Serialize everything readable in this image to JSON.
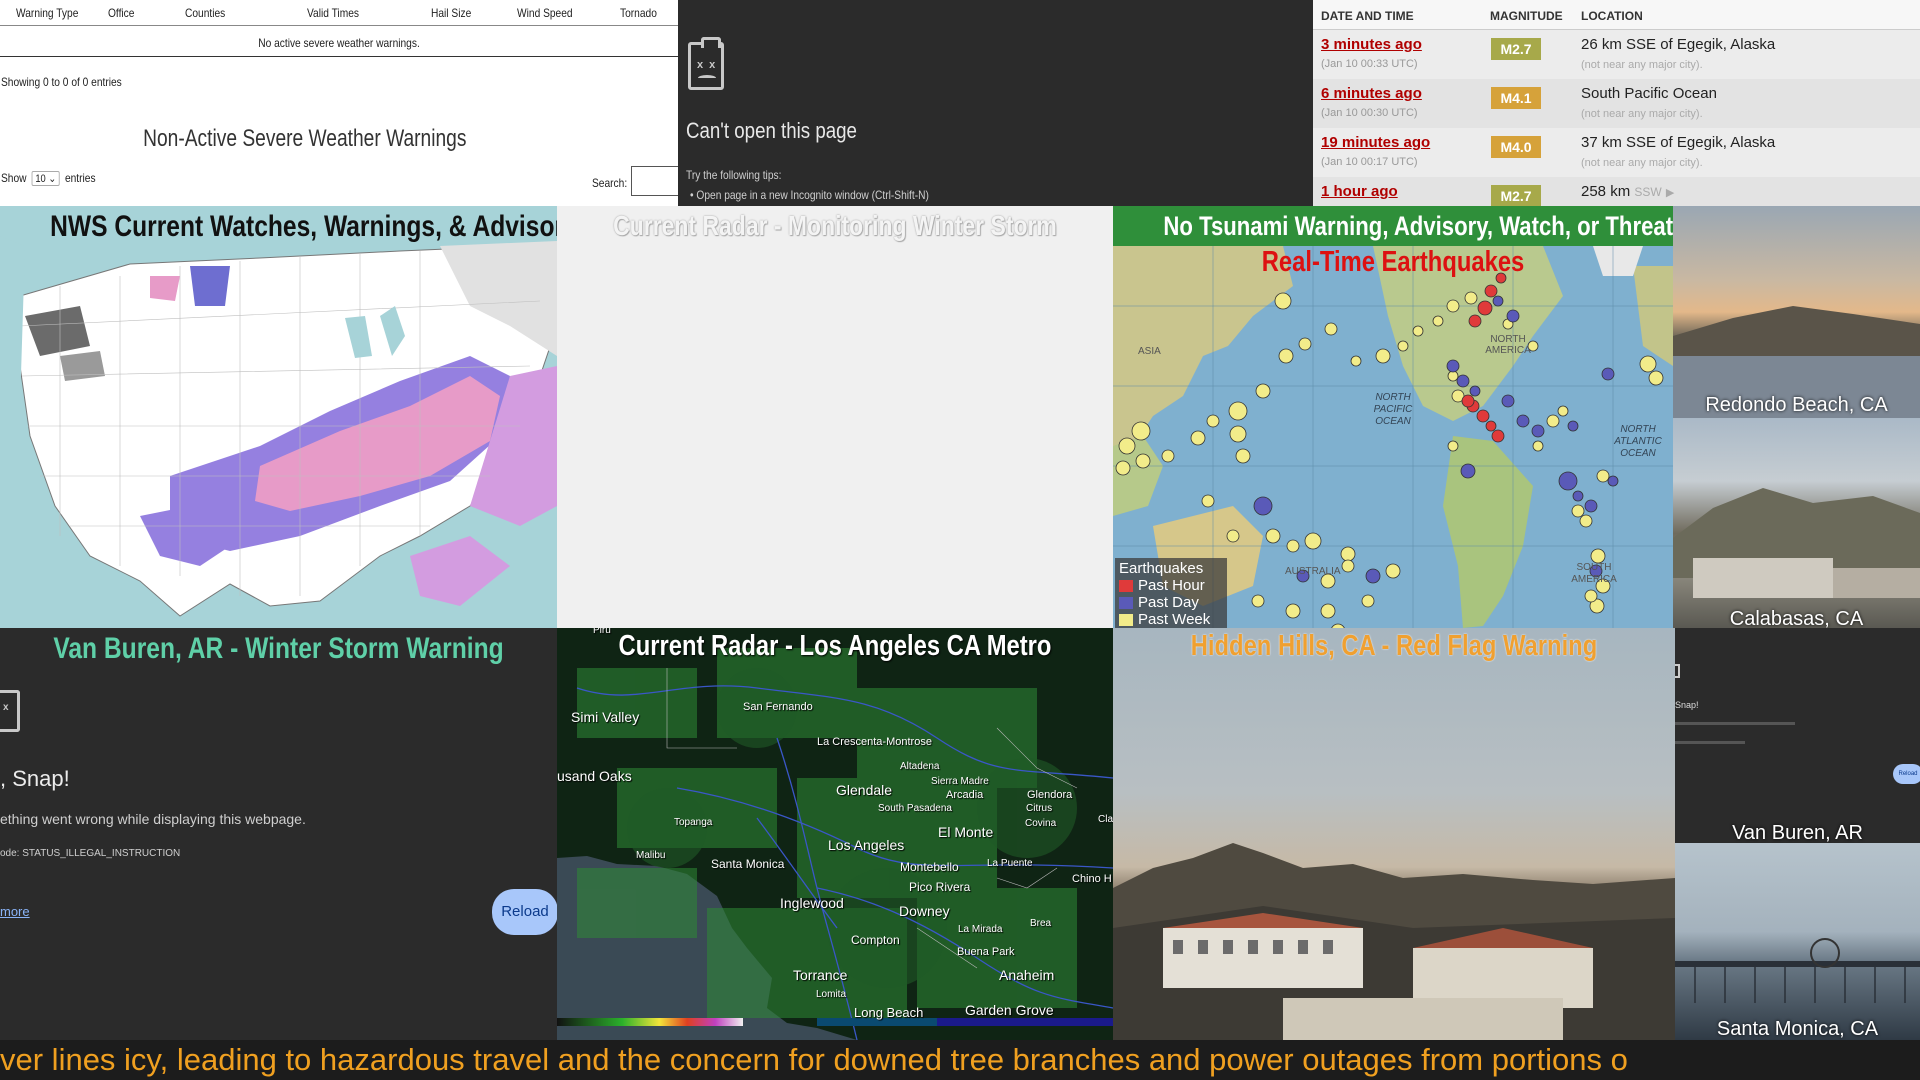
{
  "warnings_table": {
    "columns": [
      "Warning Type",
      "Office",
      "Counties",
      "Valid Times",
      "Hail Size",
      "Wind Speed",
      "Tornado"
    ],
    "empty_text": "No active severe weather warnings.",
    "showing_text": "Showing 0 to 0 of 0 entries",
    "section_title": "Non-Active Severe Weather Warnings",
    "show_label": "Show",
    "show_value": "10",
    "entries_label": "entries",
    "search_label": "Search:"
  },
  "error_page": {
    "title": "Can't open this page",
    "tips_label": "Try the following tips:",
    "tip_1": "Open page in a new Incognito window (Ctrl-Shift-N)"
  },
  "quake_table": {
    "headers": [
      "DATE AND TIME",
      "MAGNITUDE",
      "LOCATION"
    ],
    "rows": [
      {
        "time": "3 minutes ago",
        "utc": "(Jan 10 00:33 UTC)",
        "mag": "M2.7",
        "location": "26 km SSE of Egegik, Alaska",
        "near": "(not near any major city)."
      },
      {
        "time": "6 minutes ago",
        "utc": "(Jan 10 00:30 UTC)",
        "mag": "M4.1",
        "location": "South Pacific Ocean",
        "near": "(not near any major city)."
      },
      {
        "time": "19 minutes ago",
        "utc": "(Jan 10 00:17 UTC)",
        "mag": "M4.0",
        "location": "37 km SSE of Egegik, Alaska",
        "near": "(not near any major city)."
      },
      {
        "time": "1 hour ago",
        "utc": "",
        "mag": "M2.7",
        "location": "258 km",
        "location_dir": "SSW"
      }
    ]
  },
  "panels": {
    "nws_title": "NWS Current Watches, Warnings, & Advisories",
    "radar_title": "Current Radar - Monitoring Winter Storm",
    "tsunami_banner": "No Tsunami Warning, Advisory, Watch, or Threat",
    "quake_map_title": "Real-Time Earthquakes",
    "van_buren_title": "Van Buren, AR - Winter Storm Warning",
    "la_radar_title": "Current Radar - Los Angeles CA Metro",
    "hidden_hills_title": "Hidden Hills, CA - Red Flag Warning"
  },
  "quake_map": {
    "labels": {
      "asia": "ASIA",
      "north_america": "NORTH AMERICA",
      "north_pacific": "NORTH PACIFIC OCEAN",
      "north_atlantic": "NORTH ATLANTIC OCEAN",
      "south_america": "SOUTH AMERICA",
      "australia": "AUSTRALIA"
    },
    "legend_title": "Earthquakes",
    "legend": [
      {
        "label": "Past Hour",
        "color": "#e03a3a"
      },
      {
        "label": "Past Day",
        "color": "#5a5ab8"
      },
      {
        "label": "Past Week",
        "color": "#f2ec8a"
      }
    ]
  },
  "webcams": {
    "redondo": "Redondo Beach, CA",
    "calabasas": "Calabasas, CA",
    "van_buren": "Van Buren, AR",
    "santa_monica": "Santa Monica, CA",
    "snap": "Snap!",
    "reload": "Reload"
  },
  "van_buren_error": {
    "heading": ", Snap!",
    "message": "ething went wrong while displaying this webpage.",
    "code": "ode: STATUS_ILLEGAL_INSTRUCTION",
    "more": "more",
    "reload": "Reload"
  },
  "la_map_cities": [
    "Piru",
    "San Fernando",
    "Simi Valley",
    "La Crescenta-Montrose",
    "Altadena",
    "Sierra Madre",
    "usand Oaks",
    "Glendale",
    "Arcadia",
    "Glendora",
    "South Pasadena",
    "Citrus",
    "Covina",
    "Topanga",
    "El Monte",
    "Cla",
    "Los Angeles",
    "Malibu",
    "Santa Monica",
    "Montebello",
    "La Puente",
    "Chino H",
    "Pico Rivera",
    "Inglewood",
    "Downey",
    "Brea",
    "La Mirada",
    "Compton",
    "Buena Park",
    "Torrance",
    "Anaheim",
    "Lomita",
    "Long Beach",
    "Garden Grove"
  ],
  "ticker_text": "ver lines icy, leading to hazardous travel and the concern for downed tree branches and power outages from portions o"
}
